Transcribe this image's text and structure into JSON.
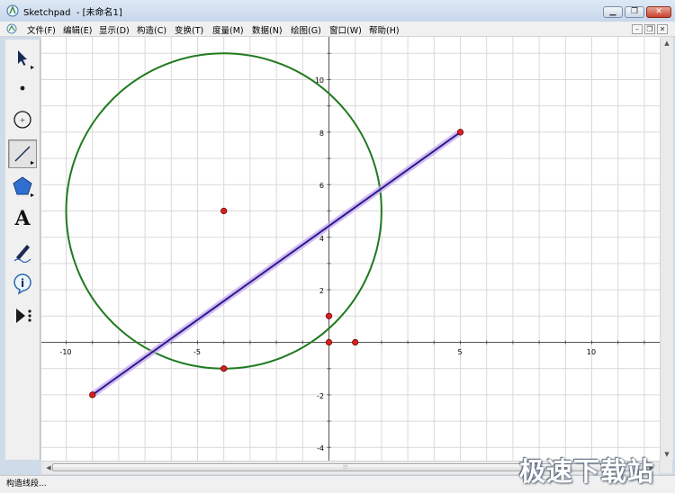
{
  "window": {
    "title": "Sketchpad  - [未命名1]"
  },
  "menu": {
    "items": [
      "文件(F)",
      "编辑(E)",
      "显示(D)",
      "构造(C)",
      "变换(T)",
      "度量(M)",
      "数据(N)",
      "绘图(G)",
      "窗口(W)",
      "帮助(H)"
    ]
  },
  "toolbox": {
    "tools": [
      {
        "name": "arrow-select-tool",
        "icon": "arrow-icon"
      },
      {
        "name": "point-tool",
        "icon": "point-icon"
      },
      {
        "name": "compass-tool",
        "icon": "circle-icon"
      },
      {
        "name": "straightedge-tool",
        "icon": "segment-icon",
        "selected": true
      },
      {
        "name": "polygon-tool",
        "icon": "pentagon-icon"
      },
      {
        "name": "text-tool",
        "icon": "text-a-icon",
        "label": "A"
      },
      {
        "name": "marker-tool",
        "icon": "pen-icon"
      },
      {
        "name": "information-tool",
        "icon": "info-icon",
        "label": "i"
      },
      {
        "name": "custom-tools",
        "icon": "play-more-icon"
      }
    ]
  },
  "graph": {
    "x_ticks": [
      "-10",
      "-5",
      "5",
      "10"
    ],
    "y_ticks": [
      "10",
      "8",
      "6",
      "4",
      "2",
      "-2",
      "-4"
    ],
    "circle": {
      "center": [
        -4,
        5
      ],
      "radius": 6,
      "color": "#1f7a1f"
    },
    "segment": {
      "from": [
        -9,
        -2
      ],
      "to": [
        5,
        8
      ],
      "color": "#2a1c8c",
      "highlight": "#c9a8ef"
    },
    "points": [
      [
        -4,
        5
      ],
      [
        -4,
        -1
      ],
      [
        -9,
        -2
      ],
      [
        5,
        8
      ],
      [
        0,
        1
      ],
      [
        0,
        0
      ],
      [
        1,
        0
      ]
    ],
    "point_color": "#d92020"
  },
  "status": {
    "text": "构造线段..."
  },
  "watermark": {
    "text": "极速下载站"
  }
}
